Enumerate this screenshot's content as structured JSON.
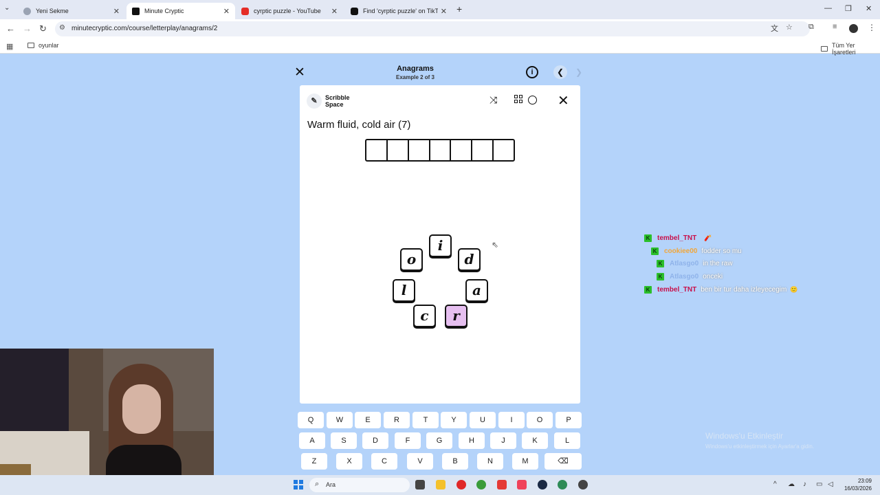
{
  "browser": {
    "tabs": [
      {
        "title": "Yeni Sekme",
        "active": false
      },
      {
        "title": "Minute Cryptic",
        "active": true
      },
      {
        "title": "cyrptic puzzle - YouTube",
        "active": false
      },
      {
        "title": "Find 'cyrptic puzzle' on TikTok",
        "active": false
      }
    ],
    "url": "minutecryptic.com/course/letterplay/anagrams/2",
    "bookmarks": {
      "folder": "oyunlar",
      "all": "Tüm Yer İşaretleri"
    }
  },
  "header": {
    "title": "Anagrams",
    "subtitle": "Example 2 of 3"
  },
  "card": {
    "brand_line1": "Scribble",
    "brand_line2": "Space",
    "clue": "Warm fluid, cold air (7)",
    "answer_length": 7,
    "tiles": [
      {
        "letter": "i",
        "highlight": false
      },
      {
        "letter": "o",
        "highlight": false
      },
      {
        "letter": "d",
        "highlight": false
      },
      {
        "letter": "l",
        "highlight": false
      },
      {
        "letter": "a",
        "highlight": false
      },
      {
        "letter": "c",
        "highlight": false
      },
      {
        "letter": "r",
        "highlight": true
      }
    ]
  },
  "keyboard": {
    "row1": [
      "Q",
      "W",
      "E",
      "R",
      "T",
      "Y",
      "U",
      "I",
      "O",
      "P"
    ],
    "row2": [
      "A",
      "S",
      "D",
      "F",
      "G",
      "H",
      "J",
      "K",
      "L"
    ],
    "row3": [
      "Z",
      "X",
      "C",
      "V",
      "B",
      "N",
      "M",
      "⌫"
    ]
  },
  "chat": [
    {
      "user": "tembel_TNT",
      "user_color": "#c8104a",
      "message": "",
      "emote": "🧨"
    },
    {
      "user": "cookiee00",
      "user_color": "#f2a73a",
      "message": "fodder so mu",
      "emote": ""
    },
    {
      "user": "Atlasgo0",
      "user_color": "#8fb3ea",
      "message": "in the raw",
      "emote": ""
    },
    {
      "user": "Atlasgo0",
      "user_color": "#8fb3ea",
      "message": "onceki",
      "emote": ""
    },
    {
      "user": "tembel_TNT",
      "user_color": "#c8104a",
      "message": "ben bir tur daha izleyecegim",
      "emote": "🙂"
    }
  ],
  "watermark": {
    "line1": "Windows'u Etkinleştir",
    "line2": "Windows'u etkinleştirmek için Ayarlar'a gidin."
  },
  "taskbar": {
    "search_text": "Ara",
    "time": "23:09",
    "date": "16/03/2026"
  }
}
